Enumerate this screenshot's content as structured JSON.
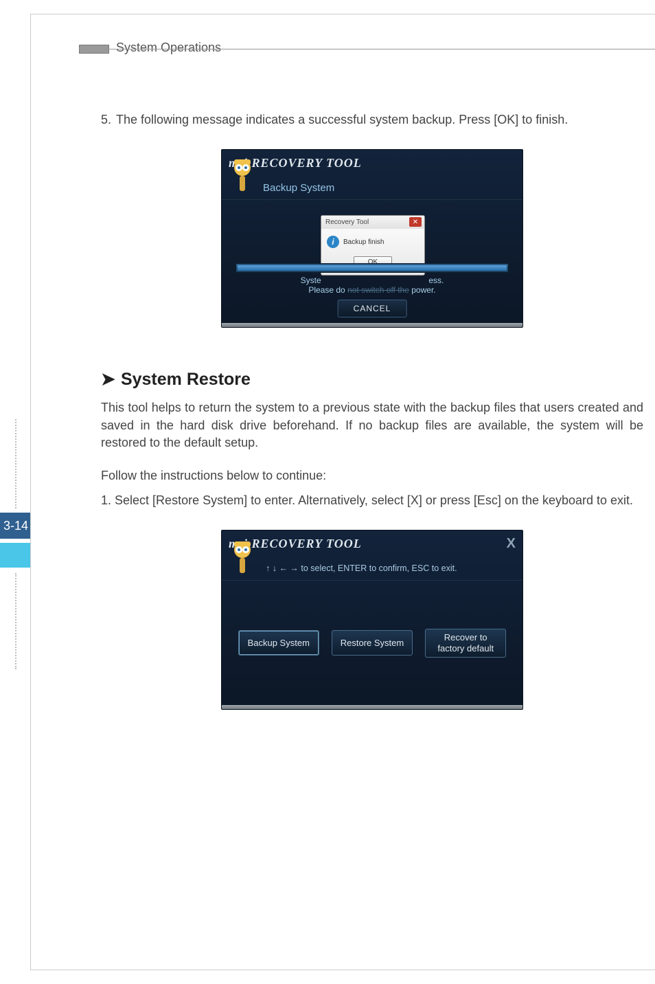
{
  "header": {
    "title": "System Operations"
  },
  "page_number": "3-14",
  "step5": {
    "number": "5.",
    "text": "The following message indicates a successful system backup. Press [OK] to finish."
  },
  "screenshot1": {
    "logo_msi": "msi",
    "logo_title": "RECOVERY TOOL",
    "subtitle": "Backup System",
    "dialog": {
      "title": "Recovery Tool",
      "close_glyph": "✕",
      "info_glyph": "i",
      "message": "Backup finish",
      "ok_label": "OK"
    },
    "progress_text_left": "Syste",
    "progress_text_right": "ess.",
    "progress_text2_pre": "Please do ",
    "progress_text2_hidden": "not switch off the",
    "progress_text2_post": " power.",
    "cancel_label": "CANCEL"
  },
  "section": {
    "chevron": "➤",
    "title": "System Restore",
    "paragraph": "This tool helps to return the system to a previous state with the backup files that  users created and saved in the hard disk drive beforehand. If no backup files are available, the system will be restored to the default setup.",
    "follow": "Follow the instructions below to continue:",
    "step1_number": "1.",
    "step1_text": "Select [Restore System] to enter. Alternatively, select [X] or press [Esc] on the keyboard to exit."
  },
  "screenshot2": {
    "logo_msi": "msi",
    "logo_title": "RECOVERY TOOL",
    "close_glyph": "X",
    "subtitle": "↑ ↓ ← → to select, ENTER to confirm, ESC to exit.",
    "buttons": {
      "backup": "Backup System",
      "restore": "Restore System",
      "recover_line1": "Recover to",
      "recover_line2": "factory default"
    }
  }
}
